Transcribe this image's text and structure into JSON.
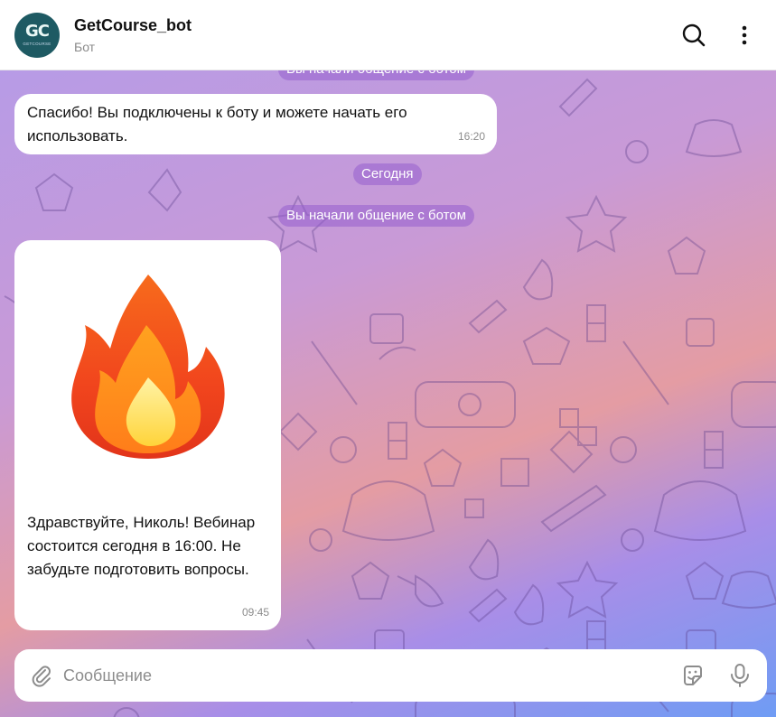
{
  "header": {
    "avatar_text": "GC",
    "avatar_sub": "GETCOURSE",
    "title": "GetCourse_bot",
    "subtitle": "Бот"
  },
  "messages": {
    "partial_pill": "Вы начали общение с ботом",
    "welcome_text": "Спасибо! Вы подключены к боту и можете начать его использовать.",
    "welcome_time": "16:20",
    "date_pill": "Сегодня",
    "start_pill": "Вы начали общение с ботом",
    "reminder_text": "Здравствуйте, Николь! Вебинар состоится сегодня в 16:00. Не забудьте подготовить вопросы.",
    "reminder_time": "09:45",
    "sticker": "fire-sticker"
  },
  "composer": {
    "placeholder": "Сообщение"
  },
  "icons": [
    "search-icon",
    "more-vertical-icon",
    "paperclip-icon",
    "sticker-icon",
    "microphone-icon"
  ],
  "colors": {
    "header_bg": "#ffffff",
    "avatar_bg": "#1e5a63",
    "pill_bg": "#965fcd",
    "bubble_bg": "#ffffff"
  }
}
